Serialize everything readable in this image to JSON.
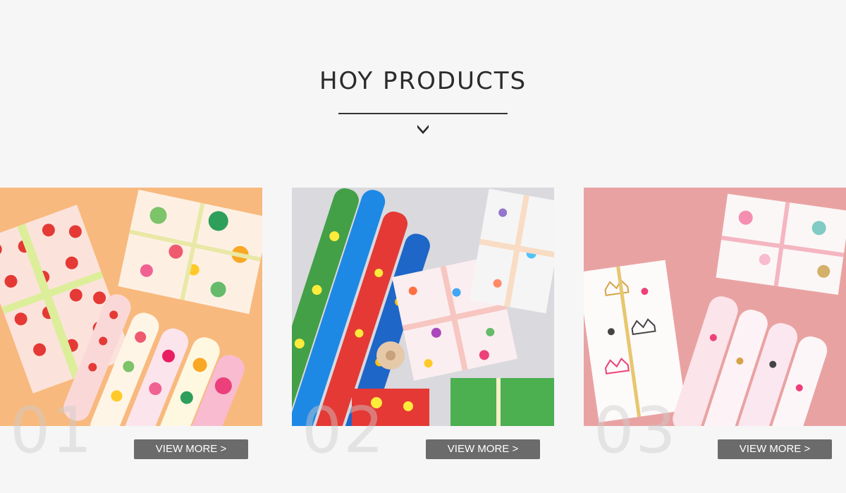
{
  "section": {
    "title": "HOY PRODUCTS"
  },
  "icons": {
    "arrow": "chevron-down-icon"
  },
  "products": [
    {
      "number": "01",
      "button_label": "VIEW MORE >"
    },
    {
      "number": "02",
      "button_label": "VIEW MORE >"
    },
    {
      "number": "03",
      "button_label": "VIEW MORE >"
    }
  ],
  "colors": {
    "background": "#f6f6f6",
    "title": "#2b2b2b",
    "button": "#6b6b6b",
    "button_text": "#ffffff"
  }
}
